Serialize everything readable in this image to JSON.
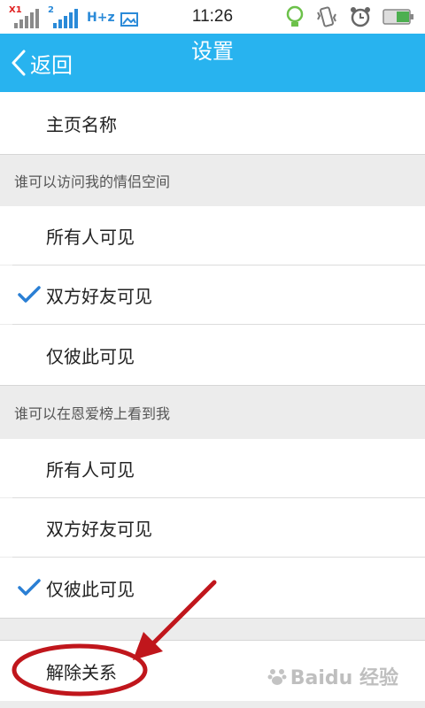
{
  "status_bar": {
    "time": "11:26",
    "sim1_tag": "X1",
    "network_type": "H+z",
    "icons": [
      "signal-bars-icon",
      "signal-bars-icon",
      "gallery-icon",
      "bulb-icon",
      "vibrate-icon",
      "alarm-clock-icon",
      "battery-icon"
    ]
  },
  "header": {
    "back_label": "返回",
    "title": "设置"
  },
  "home_name_row": {
    "label": "主页名称"
  },
  "space_visibility": {
    "header": "谁可以访问我的情侣空间",
    "options": [
      {
        "label": "所有人可见",
        "checked": false
      },
      {
        "label": "双方好友可见",
        "checked": true
      },
      {
        "label": "仅彼此可见",
        "checked": false
      }
    ]
  },
  "love_rank_visibility": {
    "header": "谁可以在恩爱榜上看到我",
    "options": [
      {
        "label": "所有人可见",
        "checked": false
      },
      {
        "label": "双方好友可见",
        "checked": false
      },
      {
        "label": "仅彼此可见",
        "checked": true
      }
    ]
  },
  "unbind_row": {
    "label": "解除关系"
  },
  "annotation": {
    "color": "#c0161c"
  },
  "watermark": {
    "text": "Baidu 经验"
  },
  "colors": {
    "accent": "#28b3ef",
    "check": "#2a7fd4",
    "background": "#ececec"
  }
}
